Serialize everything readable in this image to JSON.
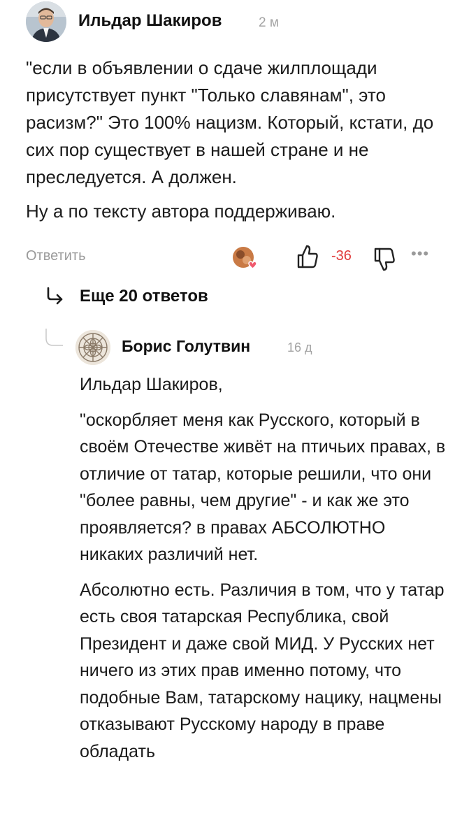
{
  "comment": {
    "author": "Ильдар Шакиров",
    "time": "2 м",
    "paragraphs": [
      "\"если в объявлении о сдаче жилплощади присутствует пункт \"Только славянам\", это расизм?\" Это 100% нацизм. Который, кстати, до сих пор существует в нашей стране и не преследуется. А должен.",
      "Ну а по тексту автора поддерживаю."
    ],
    "actions": {
      "reply_label": "Ответить",
      "rating": "-36",
      "more": "•••"
    }
  },
  "more_replies_label": "Еще 20 ответов",
  "reply": {
    "author": "Борис Голутвин",
    "time": "16 д",
    "paragraphs": [
      "Ильдар Шакиров,",
      "\"оскорбляет меня как Русского, который в своём Отечестве живёт на птичьих правах, в отличие от татар, которые решили, что они \"более равны, чем другие\" - и как же это проявляется? в правах АБСОЛЮТНО никаких различий нет.",
      "Абсолютно есть. Различия в том, что у татар есть своя татарская Республика, свой Президент и даже свой МИД. У Русских нет ничего из этих прав именно потому, что подобные Вам, татарскому нацику, нацмены отказывают Русскому народу в праве обладать"
    ]
  },
  "colors": {
    "text": "#1b1b1b",
    "muted": "#9a9a9a",
    "rating_negative": "#e03a3a",
    "reaction_heart": "#f05a6e"
  }
}
